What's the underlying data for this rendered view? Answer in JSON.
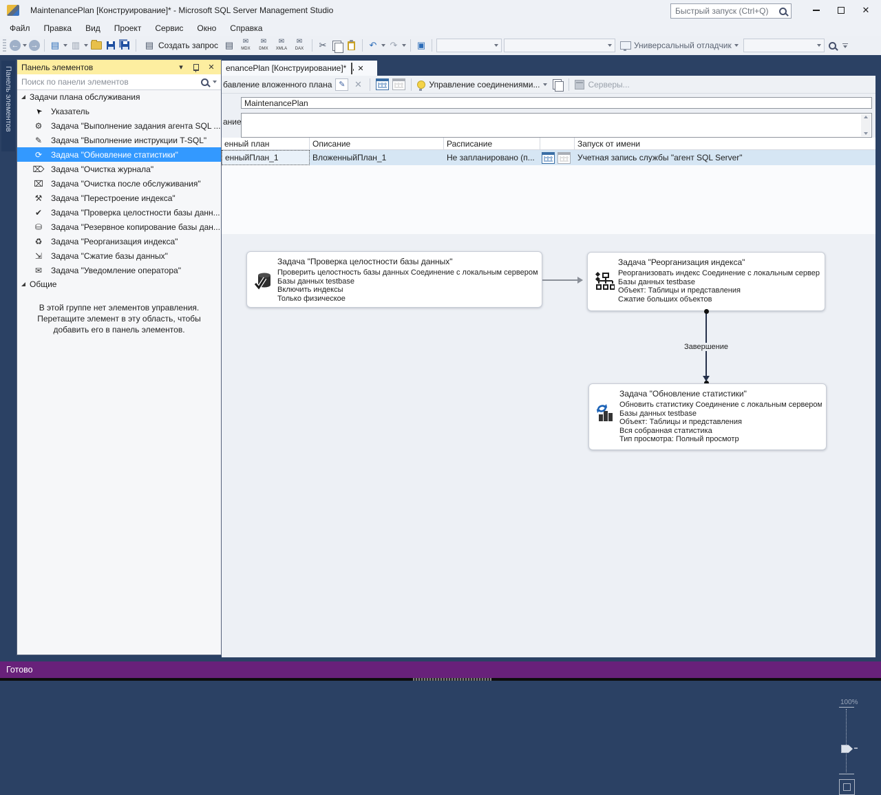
{
  "window": {
    "title": "MaintenancePlan [Конструирование]* - Microsoft SQL Server Management Studio",
    "quick_launch_placeholder": "Быстрый запуск (Ctrl+Q)"
  },
  "menu": {
    "items": [
      "Файл",
      "Правка",
      "Вид",
      "Проект",
      "Сервис",
      "Окно",
      "Справка"
    ]
  },
  "toolbar": {
    "create_query_label": "Создать запрос",
    "query_types": [
      "MDX",
      "DMX",
      "XMLA",
      "DAX"
    ],
    "debugger_label": "Универсальный отладчик"
  },
  "toolbox": {
    "side_tab_label": "Панель элементов",
    "title": "Панель элементов",
    "search_placeholder": "Поиск по панели элементов",
    "group1_label": "Задачи плана обслуживания",
    "items": [
      {
        "icon": "pointer-icon",
        "label": "Указатель"
      },
      {
        "icon": "sql-agent-job-task-icon",
        "label": "Задача \"Выполнение задания агента SQL ..."
      },
      {
        "icon": "tsql-statement-task-icon",
        "label": "Задача \"Выполнение инструкции T-SQL\""
      },
      {
        "icon": "update-statistics-task-icon",
        "label": "Задача \"Обновление статистики\"",
        "selected": true
      },
      {
        "icon": "history-cleanup-task-icon",
        "label": "Задача \"Очистка журнала\""
      },
      {
        "icon": "maintenance-cleanup-task-icon",
        "label": "Задача \"Очистка после обслуживания\""
      },
      {
        "icon": "rebuild-index-task-icon",
        "label": "Задача \"Перестроение индекса\""
      },
      {
        "icon": "check-db-integrity-task-icon",
        "label": "Задача \"Проверка целостности базы данн..."
      },
      {
        "icon": "backup-database-task-icon",
        "label": "Задача \"Резервное копирование базы дан..."
      },
      {
        "icon": "reorganize-index-task-icon",
        "label": "Задача \"Реорганизация индекса\""
      },
      {
        "icon": "shrink-database-task-icon",
        "label": "Задача \"Сжатие базы данных\""
      },
      {
        "icon": "notify-operator-task-icon",
        "label": "Задача \"Уведомление оператора\""
      }
    ],
    "group2_label": "Общие",
    "empty_group_text": "В этой группе нет элементов управления. Перетащите элемент в эту область, чтобы добавить его в панель элементов."
  },
  "document": {
    "tab_label": "enancePlan [Конструирование]*",
    "toolbar": {
      "add_subplan_label": "бавление вложенного плана",
      "manage_connections_label": "Управление соединениями...",
      "servers_label": "Серверы..."
    },
    "plan_name": "MaintenancePlan",
    "description_label": "ание:",
    "grid": {
      "columns": {
        "subplan": "енный план",
        "description": "Описание",
        "schedule": "Расписание",
        "run_as": "Запуск от имени"
      },
      "row": {
        "subplan": "енныйПлан_1",
        "description": "ВложенныйПлан_1",
        "schedule": "Не запланировано (п...",
        "run_as": "Учетная запись службы \"агент SQL Server\""
      }
    }
  },
  "designer": {
    "tasks": [
      {
        "icon": "check-db-integrity-icon",
        "title": "Задача \"Проверка целостности базы данных\"",
        "lines": [
          "Проверить целостность базы данных Соединение с локальным сервером",
          "Базы данных testbase",
          "Включить индексы",
          "Только физическое"
        ]
      },
      {
        "icon": "reorganize-index-icon",
        "title": "Задача \"Реорганизация индекса\"",
        "lines": [
          "Реорганизовать индекс Соединение с локальным сервер",
          "Базы данных testbase",
          "Объект: Таблицы и представления",
          "Сжатие больших объектов"
        ]
      },
      {
        "icon": "update-statistics-icon",
        "title": "Задача \"Обновление статистики\"",
        "lines": [
          "Обновить статистику Соединение с локальным сервером",
          "Базы данных testbase",
          "Объект: Таблицы и представления",
          "Вся собранная статистика",
          "Тип просмотра: Полный просмотр"
        ]
      }
    ],
    "connector_label": "Завершение",
    "zoom_label": "100%"
  },
  "status_bar": {
    "text": "Готово"
  },
  "icon_glyphs": {
    "pointer-icon": "➤",
    "sql-agent-job-task-icon": "⚙",
    "tsql-statement-task-icon": "✎",
    "update-statistics-task-icon": "⟳",
    "history-cleanup-task-icon": "⌦",
    "maintenance-cleanup-task-icon": "⌧",
    "rebuild-index-task-icon": "⚒",
    "check-db-integrity-task-icon": "✔",
    "backup-database-task-icon": "⛁",
    "reorganize-index-task-icon": "♻",
    "shrink-database-task-icon": "⇲",
    "notify-operator-task-icon": "✉",
    "mail-icon": "✉",
    "close-icon": "✕",
    "window-caret-icon": "▾",
    "scissors-icon": "✂",
    "undo-icon": "↶",
    "redo-icon": "↷",
    "back-icon": "←",
    "forward-icon": "→",
    "new-query-sheet-icon": "▤",
    "new-window-icon": "▤",
    "disabled-window-icon": "▥",
    "intellisense-icon": "▣",
    "edit-icon": "✎",
    "delete-icon": "✕",
    "search-caret-icon": "▾"
  },
  "colors": {
    "selection_blue": "#3399ff",
    "status_purple": "#68217a",
    "toolbox_header_yellow": "#fdeea0",
    "dock_background": "#2b4164"
  }
}
